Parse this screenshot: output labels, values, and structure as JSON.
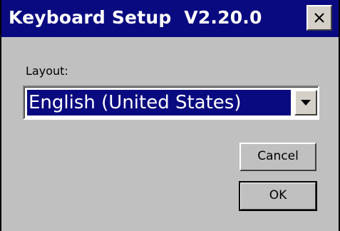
{
  "window": {
    "title": "Keyboard Setup  V2.20.0",
    "close_label": "×"
  },
  "form": {
    "layout_label": "Layout:",
    "layout_value": "English (United States)"
  },
  "buttons": {
    "cancel_label": "Cancel",
    "ok_label": "OK"
  },
  "colors": {
    "titlebar": "#0a0a80",
    "selection": "#0a0a80",
    "dialog_bg": "#c0c0c0"
  },
  "icons": {
    "close": "close-icon",
    "dropdown": "chevron-down-icon"
  }
}
